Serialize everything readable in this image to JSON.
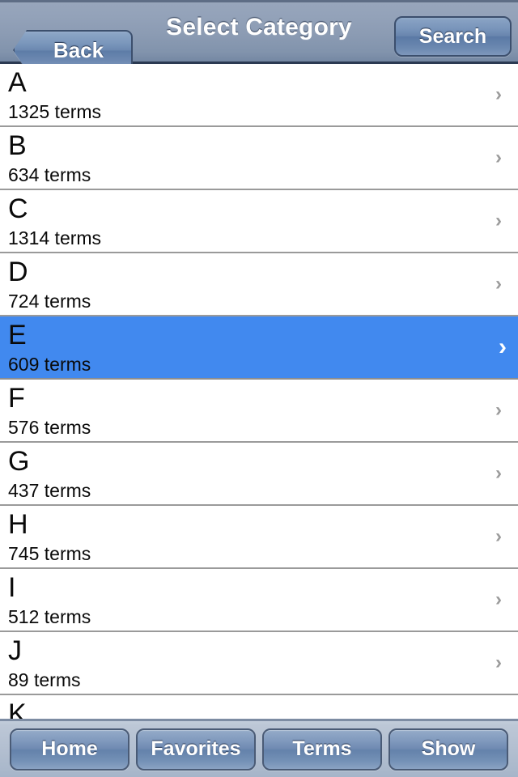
{
  "navbar": {
    "back_label": "Back",
    "title": "Select Category",
    "search_label": "Search",
    "back_icon": "chevron-left-icon"
  },
  "list": {
    "chevron_glyph": "›",
    "selected_chevron_glyph": "›",
    "rows": [
      {
        "letter": "A",
        "subtitle": "1325 terms",
        "count": 1325,
        "selected": false
      },
      {
        "letter": "B",
        "subtitle": "634 terms",
        "count": 634,
        "selected": false
      },
      {
        "letter": "C",
        "subtitle": "1314 terms",
        "count": 1314,
        "selected": false
      },
      {
        "letter": "D",
        "subtitle": "724 terms",
        "count": 724,
        "selected": false
      },
      {
        "letter": "E",
        "subtitle": "609 terms",
        "count": 609,
        "selected": true
      },
      {
        "letter": "F",
        "subtitle": "576 terms",
        "count": 576,
        "selected": false
      },
      {
        "letter": "G",
        "subtitle": "437 terms",
        "count": 437,
        "selected": false
      },
      {
        "letter": "H",
        "subtitle": "745 terms",
        "count": 745,
        "selected": false
      },
      {
        "letter": "I",
        "subtitle": "512 terms",
        "count": 512,
        "selected": false
      },
      {
        "letter": "J",
        "subtitle": "89 terms",
        "count": 89,
        "selected": false
      },
      {
        "letter": "K",
        "subtitle": "",
        "count": null,
        "selected": false
      }
    ]
  },
  "toolbar": {
    "buttons": [
      {
        "label": "Home"
      },
      {
        "label": "Favorites"
      },
      {
        "label": "Terms"
      },
      {
        "label": "Show"
      }
    ]
  },
  "colors": {
    "navbar_top": "#9aa8bd",
    "navbar_bottom": "#5f7393",
    "selection_blue": "#4189ef",
    "toolbar_bg": "#b4c0d1",
    "button_blue": "#6f8ab2",
    "separator": "#9a9a9a",
    "text_primary": "#0a0a0a",
    "chevron_gray": "#9b9b9b"
  }
}
